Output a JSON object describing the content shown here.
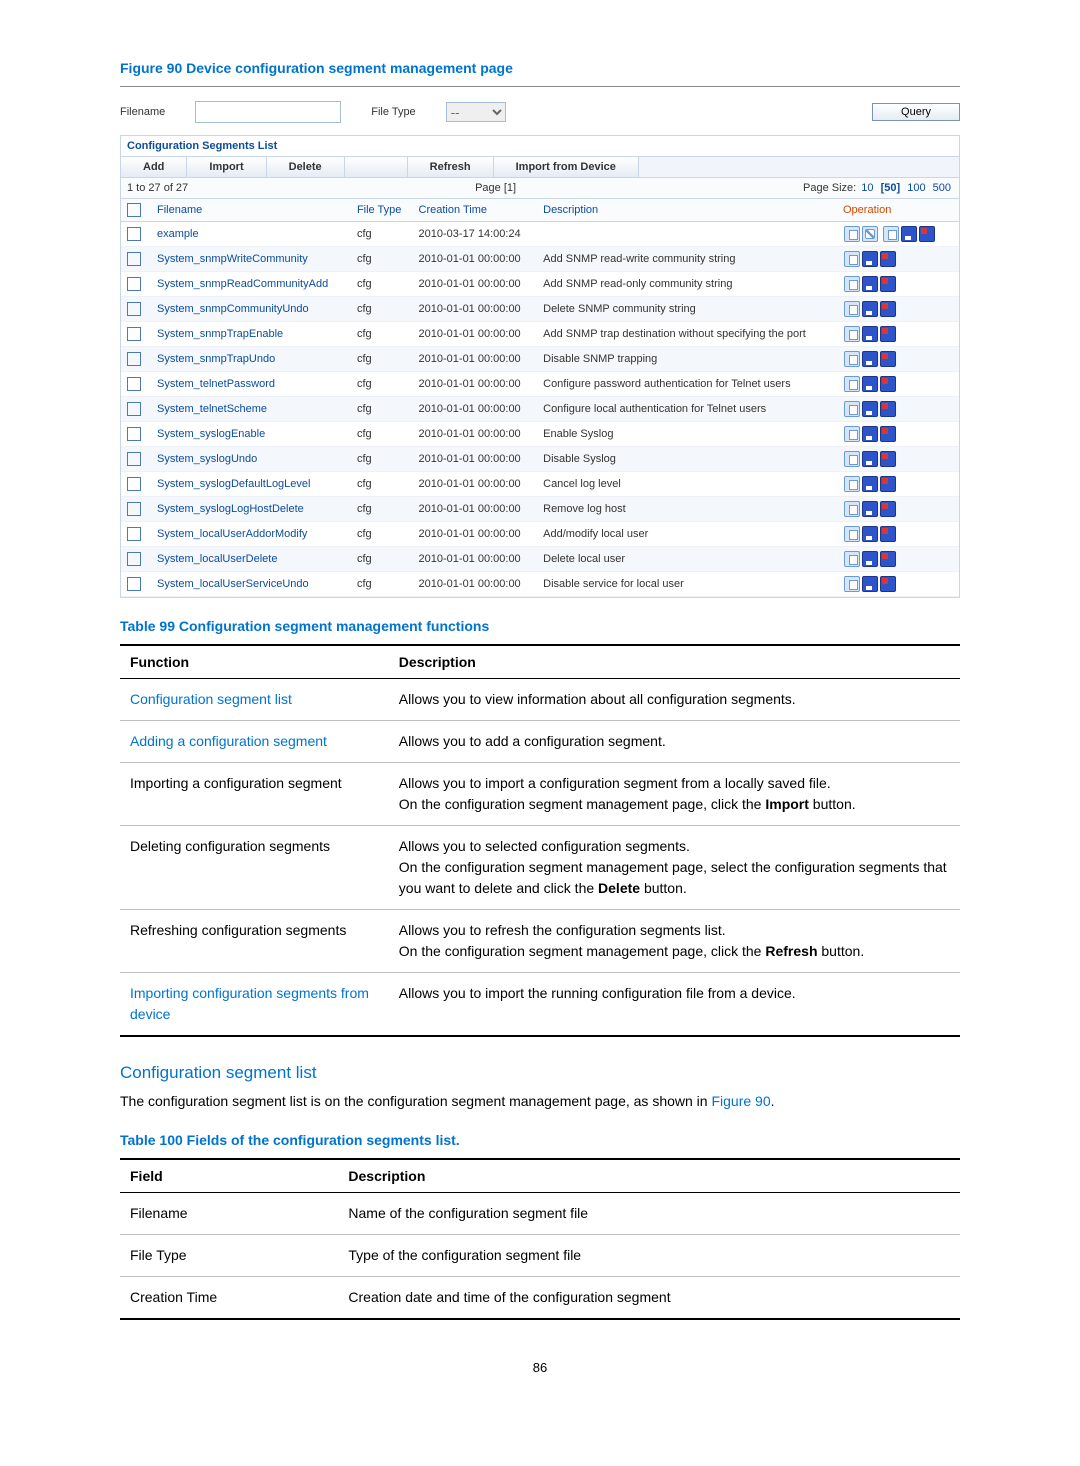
{
  "figure_title": "Figure 90 Device configuration segment management page",
  "filter": {
    "filename_label": "Filename",
    "filetype_label": "File Type",
    "filetype_value": "--",
    "query": "Query"
  },
  "seglist": {
    "title": "Configuration Segments List",
    "buttons": {
      "add": "Add",
      "import": "Import",
      "delete": "Delete",
      "refresh": "Refresh",
      "importdev": "Import from Device"
    },
    "pager": {
      "range": "1 to 27 of 27",
      "page": "Page [1]",
      "sizelabel": "Page Size:",
      "sizes": [
        "10",
        "[50]",
        "100",
        "500"
      ]
    },
    "cols": {
      "filename": "Filename",
      "filetype": "File Type",
      "ctime": "Creation Time",
      "desc": "Description",
      "op": "Operation"
    },
    "rows": [
      {
        "name": "example",
        "type": "cfg",
        "time": "2010-03-17 14:00:24",
        "desc": "",
        "extra": true
      },
      {
        "name": "System_snmpWriteCommunity",
        "type": "cfg",
        "time": "2010-01-01 00:00:00",
        "desc": "Add SNMP read-write community string"
      },
      {
        "name": "System_snmpReadCommunityAdd",
        "type": "cfg",
        "time": "2010-01-01 00:00:00",
        "desc": "Add SNMP read-only community string"
      },
      {
        "name": "System_snmpCommunityUndo",
        "type": "cfg",
        "time": "2010-01-01 00:00:00",
        "desc": "Delete SNMP community string"
      },
      {
        "name": "System_snmpTrapEnable",
        "type": "cfg",
        "time": "2010-01-01 00:00:00",
        "desc": "Add SNMP trap destination without specifying the port"
      },
      {
        "name": "System_snmpTrapUndo",
        "type": "cfg",
        "time": "2010-01-01 00:00:00",
        "desc": "Disable SNMP trapping"
      },
      {
        "name": "System_telnetPassword",
        "type": "cfg",
        "time": "2010-01-01 00:00:00",
        "desc": "Configure password authentication for Telnet users"
      },
      {
        "name": "System_telnetScheme",
        "type": "cfg",
        "time": "2010-01-01 00:00:00",
        "desc": "Configure local authentication for Telnet users"
      },
      {
        "name": "System_syslogEnable",
        "type": "cfg",
        "time": "2010-01-01 00:00:00",
        "desc": "Enable Syslog"
      },
      {
        "name": "System_syslogUndo",
        "type": "cfg",
        "time": "2010-01-01 00:00:00",
        "desc": "Disable Syslog"
      },
      {
        "name": "System_syslogDefaultLogLevel",
        "type": "cfg",
        "time": "2010-01-01 00:00:00",
        "desc": "Cancel log level"
      },
      {
        "name": "System_syslogLogHostDelete",
        "type": "cfg",
        "time": "2010-01-01 00:00:00",
        "desc": "Remove log host"
      },
      {
        "name": "System_localUserAddorModify",
        "type": "cfg",
        "time": "2010-01-01 00:00:00",
        "desc": "Add/modify local user"
      },
      {
        "name": "System_localUserDelete",
        "type": "cfg",
        "time": "2010-01-01 00:00:00",
        "desc": "Delete local user"
      },
      {
        "name": "System_localUserServiceUndo",
        "type": "cfg",
        "time": "2010-01-01 00:00:00",
        "desc": "Disable service for local user"
      }
    ]
  },
  "table99": {
    "title": "Table 99 Configuration segment management functions",
    "cols": {
      "fn": "Function",
      "desc": "Description"
    },
    "rows": [
      {
        "fn": "Configuration segment list",
        "link": true,
        "desc": "Allows you to view information about all configuration segments."
      },
      {
        "fn": "Adding a configuration segment",
        "link": true,
        "desc": "Allows you to add a configuration segment."
      },
      {
        "fn": "Importing a configuration segment",
        "desc": "Allows you to import a configuration segment from a locally saved file.<br>On the configuration segment management page, click the <b>Import</b> button."
      },
      {
        "fn": "Deleting configuration segments",
        "desc": "Allows you to selected configuration segments.<br>On the configuration segment management page, select the configuration segments that you want to delete and click the <b>Delete</b> button."
      },
      {
        "fn": "Refreshing configuration segments",
        "desc": "Allows you to refresh the configuration segments list.<br>On the configuration segment management page, click the <b>Refresh</b> button."
      },
      {
        "fn": "Importing configuration segments from device",
        "link": true,
        "desc": "Allows you to import the running configuration file from a device."
      }
    ]
  },
  "section": {
    "title": "Configuration segment list",
    "body": "The configuration segment list is on the configuration segment management page, as shown in ",
    "fig": "Figure 90",
    "period": "."
  },
  "table100": {
    "title": "Table 100 Fields of the configuration segments list.",
    "cols": {
      "field": "Field",
      "desc": "Description"
    },
    "rows": [
      {
        "field": "Filename",
        "desc": "Name of the configuration segment file"
      },
      {
        "field": "File Type",
        "desc": "Type of the configuration segment file"
      },
      {
        "field": "Creation Time",
        "desc": "Creation date and time of the configuration segment"
      }
    ]
  },
  "pagenum": "86"
}
